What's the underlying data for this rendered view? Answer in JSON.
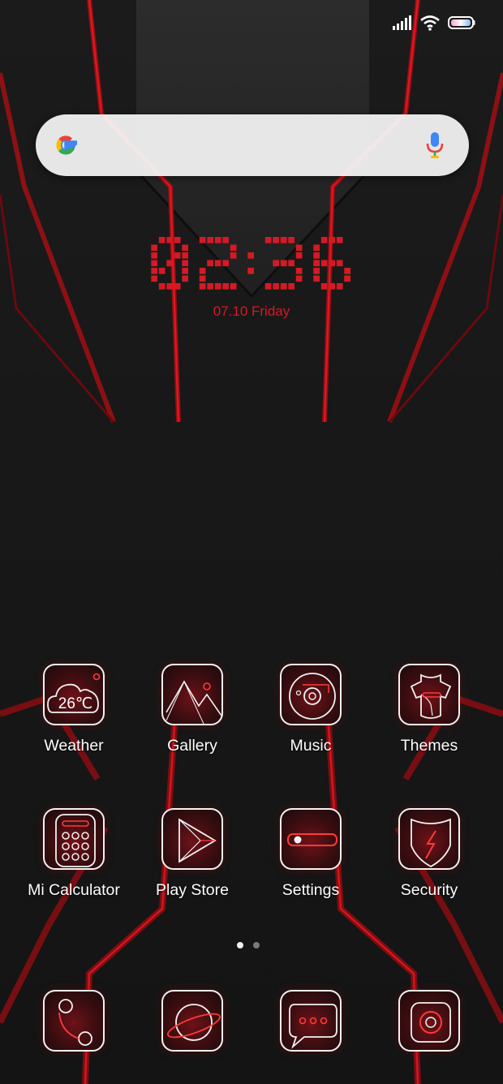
{
  "status_bar": {
    "signal_icon": "signal-bars-icon",
    "wifi_icon": "wifi-icon",
    "battery_icon": "battery-icon"
  },
  "search": {
    "logo_icon": "google-g-icon",
    "mic_icon": "microphone-icon"
  },
  "clock_widget": {
    "time": "02:36",
    "date": "07.10 Friday",
    "color": "#d41a24"
  },
  "apps": [
    {
      "label": "Weather",
      "icon": "weather-cloud-icon",
      "badge": "26℃"
    },
    {
      "label": "Gallery",
      "icon": "mountain-icon"
    },
    {
      "label": "Music",
      "icon": "music-disc-icon"
    },
    {
      "label": "Themes",
      "icon": "themes-shirt-icon"
    },
    {
      "label": "Mi Calculator",
      "icon": "calculator-icon"
    },
    {
      "label": "Play Store",
      "icon": "play-store-icon"
    },
    {
      "label": "Settings",
      "icon": "settings-toggle-icon"
    },
    {
      "label": "Security",
      "icon": "security-shield-icon"
    }
  ],
  "page_indicator": {
    "pages": 2,
    "current": 1
  },
  "dock": [
    {
      "icon": "phone-icon"
    },
    {
      "icon": "browser-planet-icon"
    },
    {
      "icon": "messages-icon"
    },
    {
      "icon": "camera-icon"
    }
  ],
  "colors": {
    "accent": "#d41a24",
    "background": "#161616"
  }
}
